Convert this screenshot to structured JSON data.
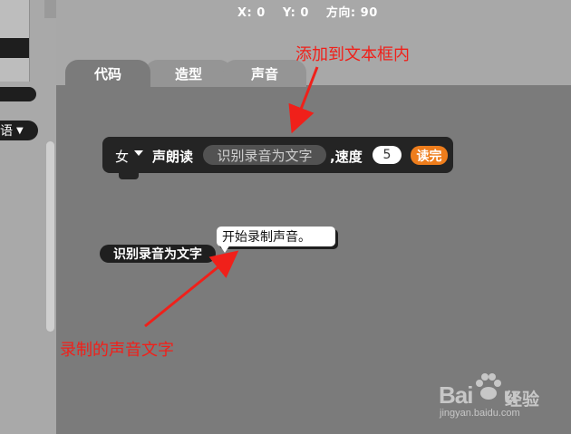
{
  "stage_info": {
    "x_label": "X: 0",
    "y_label": "Y: 0",
    "direction_label": "方向: 90"
  },
  "tabs": [
    {
      "label": "代码",
      "active": true
    },
    {
      "label": "造型",
      "active": false
    },
    {
      "label": "声音",
      "active": false
    }
  ],
  "left_panel": {
    "language_fragment": "语"
  },
  "tts_block": {
    "voice_value": "女",
    "read_label": "声朗读",
    "text_slot": "识别录音为文字",
    "speed_label": ",速度",
    "speed_value": "5",
    "done_label": "读完"
  },
  "recognition_reporter": {
    "label": "识别录音为文字"
  },
  "speech_bubble": {
    "text": "开始录制声音。"
  },
  "annotations": {
    "top": "添加到文本框内",
    "bottom": "录制的声音文字",
    "color": "#f0201a"
  },
  "watermark": {
    "logo_left": "Bai",
    "logo_right": "u",
    "brand": "经验",
    "url": "jingyan.baidu.com"
  },
  "colors": {
    "workspace": "#7b7b7b",
    "block": "#242424",
    "done_button": "#ee7d1c",
    "header": "#a8a8a8"
  },
  "icons": {
    "voice_dropdown": "chevron-down-icon",
    "language_dropdown": "chevron-down-icon",
    "watermark": "paw-icon"
  }
}
